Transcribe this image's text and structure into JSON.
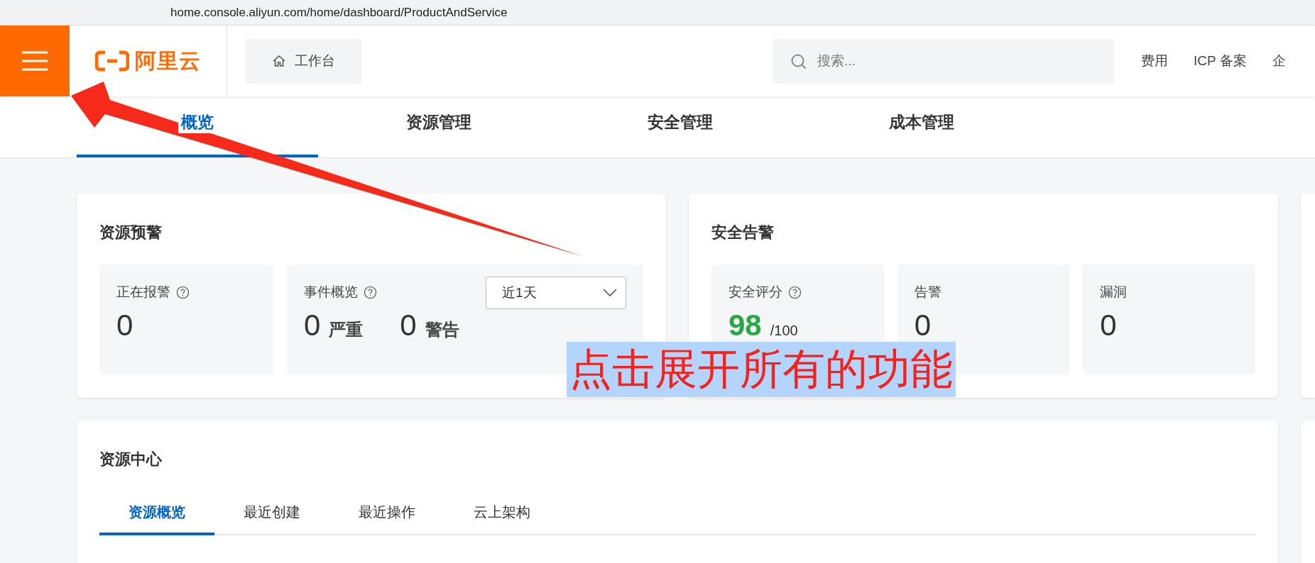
{
  "browser": {
    "url": "home.console.aliyun.com/home/dashboard/ProductAndService"
  },
  "header": {
    "logo": "阿里云",
    "workbench": "工作台",
    "search": {
      "placeholder": "搜索..."
    },
    "links": [
      "费用",
      "ICP 备案",
      "企"
    ]
  },
  "tabs": [
    {
      "label": "概览",
      "selected": true
    },
    {
      "label": "资源管理",
      "selected": false
    },
    {
      "label": "安全管理",
      "selected": false
    },
    {
      "label": "成本管理",
      "selected": false
    }
  ],
  "resource_alert": {
    "title": "资源预警",
    "tiles": [
      {
        "kind": "count",
        "label": "正在报警",
        "help": true,
        "value": "0"
      },
      {
        "kind": "events",
        "label": "事件概览",
        "help": true,
        "dropdown": "近1天",
        "stats": [
          {
            "value": "0",
            "label": "严重"
          },
          {
            "value": "0",
            "label": "警告"
          }
        ]
      }
    ]
  },
  "security_alert": {
    "title": "安全告警",
    "tiles": [
      {
        "kind": "score",
        "label": "安全评分",
        "help": true,
        "value": "98",
        "suffix": "/100"
      },
      {
        "kind": "count",
        "label": "告警",
        "help": false,
        "value": "0"
      },
      {
        "kind": "count",
        "label": "漏洞",
        "help": false,
        "value": "0"
      }
    ]
  },
  "resource_center": {
    "title": "资源中心",
    "tabs": [
      {
        "label": "资源概览",
        "selected": true
      },
      {
        "label": "最近创建",
        "selected": false
      },
      {
        "label": "最近操作",
        "selected": false
      },
      {
        "label": "云上架构",
        "selected": false
      }
    ]
  },
  "annotation": {
    "text": "点击展开所有的功能"
  }
}
